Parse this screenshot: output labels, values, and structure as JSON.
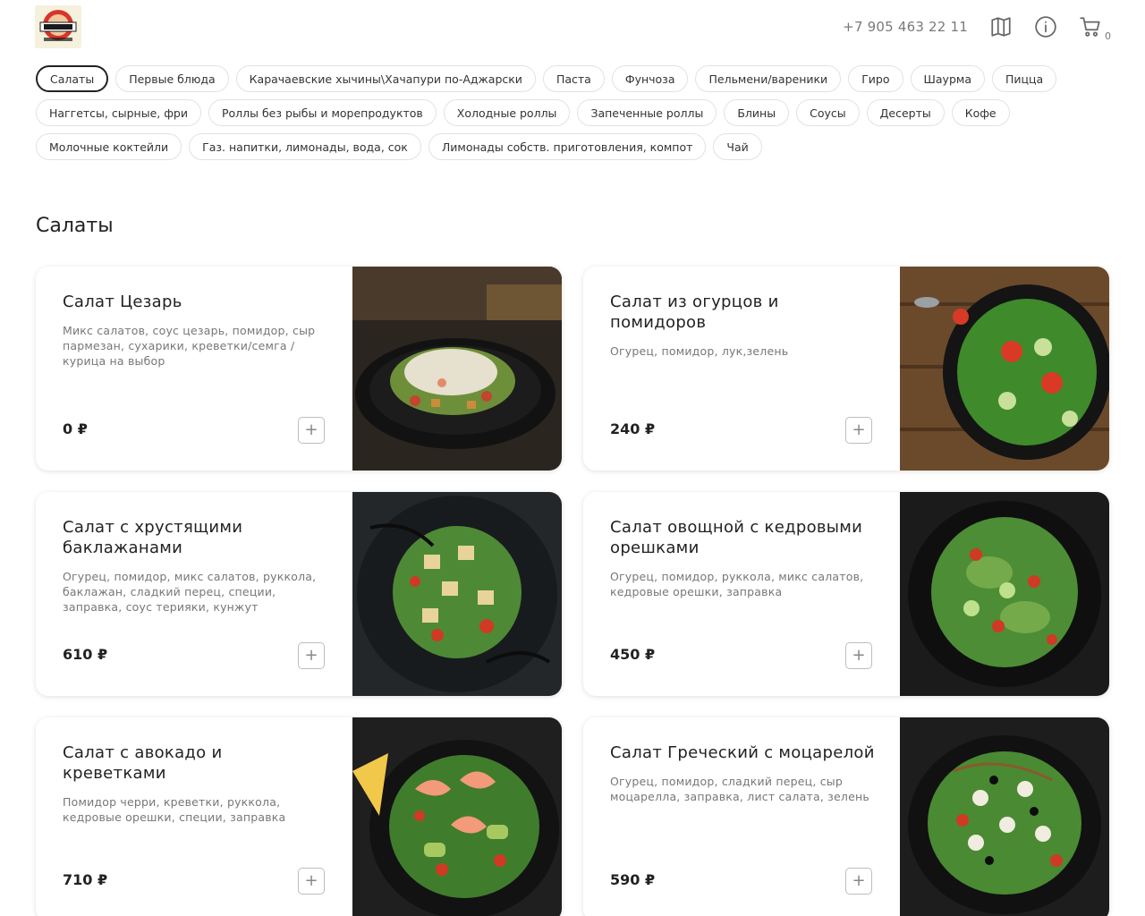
{
  "header": {
    "logo_alt": "EAT ME",
    "phone": "+7 905 463 22 11",
    "icons": [
      "map-icon",
      "info-icon",
      "cart-icon"
    ],
    "cart_count": "0"
  },
  "categories": [
    [
      "Салаты",
      "Первые блюда",
      "Карачаевские хычины\\Хачапури по-Аджарски",
      "Паста",
      "Фунчоза",
      "Пельмени/вареники",
      "Гиро",
      "Шаурма",
      "Пицца"
    ],
    [
      "Наггетсы, сырные, фри",
      "Роллы без рыбы и морепродуктов",
      "Холодные роллы",
      "Запеченные роллы",
      "Блины",
      "Соусы",
      "Десерты",
      "Кофе"
    ],
    [
      "Молочные коктейли",
      "Газ. напитки, лимонады, вода, сок",
      "Лимонады собств. приготовления, компот",
      "Чай"
    ]
  ],
  "active_category": "Салаты",
  "section_title": "Салаты",
  "add_label": "+",
  "products": [
    {
      "title": "Салат Цезарь",
      "desc": "Микс салатов, соус цезарь, помидор, сыр пармезан, сухарики, креветки/семга /курица на выбор",
      "price": "0 ₽"
    },
    {
      "title": "Салат из огурцов и помидоров",
      "desc": "Огурец, помидор, лук,зелень",
      "price": "240 ₽"
    },
    {
      "title": "Салат с хрустящими баклажанами",
      "desc": "Огурец, помидор, микс салатов, руккола, баклажан, сладкий перец, специи, заправка, соус терияки, кунжут",
      "price": "610 ₽"
    },
    {
      "title": "Салат овощной с кедровыми орешками",
      "desc": "Огурец, помидор, руккола, микс салатов, кедровые орешки, заправка",
      "price": "450 ₽"
    },
    {
      "title": "Салат с авокадо и креветками",
      "desc": "Помидор черри, креветки, руккола, кедровые орешки, специи, заправка",
      "price": "710 ₽"
    },
    {
      "title": "Салат Греческий с моцарелой",
      "desc": "Огурец, помидор, сладкий перец, сыр моцарелла, заправка, лист салата, зелень",
      "price": "590 ₽"
    }
  ],
  "colors": {
    "accent": "#222222",
    "muted": "#777777",
    "border": "#e2e2e2"
  }
}
